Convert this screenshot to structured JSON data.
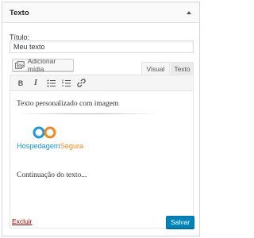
{
  "widget": {
    "title": "Texto"
  },
  "form": {
    "title_label": "Título:",
    "title_value": "Meu texto"
  },
  "media": {
    "add_label": "Adicionar mídia"
  },
  "tabs": {
    "visual": "Visual",
    "text": "Texto"
  },
  "toolbar": {
    "bold": "B",
    "italic": "I"
  },
  "content": {
    "paragraph1": "Texto personalizado com imagem",
    "logo_part1": "Hospedagem",
    "logo_part2": "Segura",
    "paragraph2": "Continuação do texto..."
  },
  "actions": {
    "delete": "Excluir",
    "save": "Salvar"
  },
  "colors": {
    "accent": "#0085ba",
    "delete": "#a00000",
    "logo_blue": "#1a9ad6",
    "logo_orange": "#f08a1c"
  }
}
